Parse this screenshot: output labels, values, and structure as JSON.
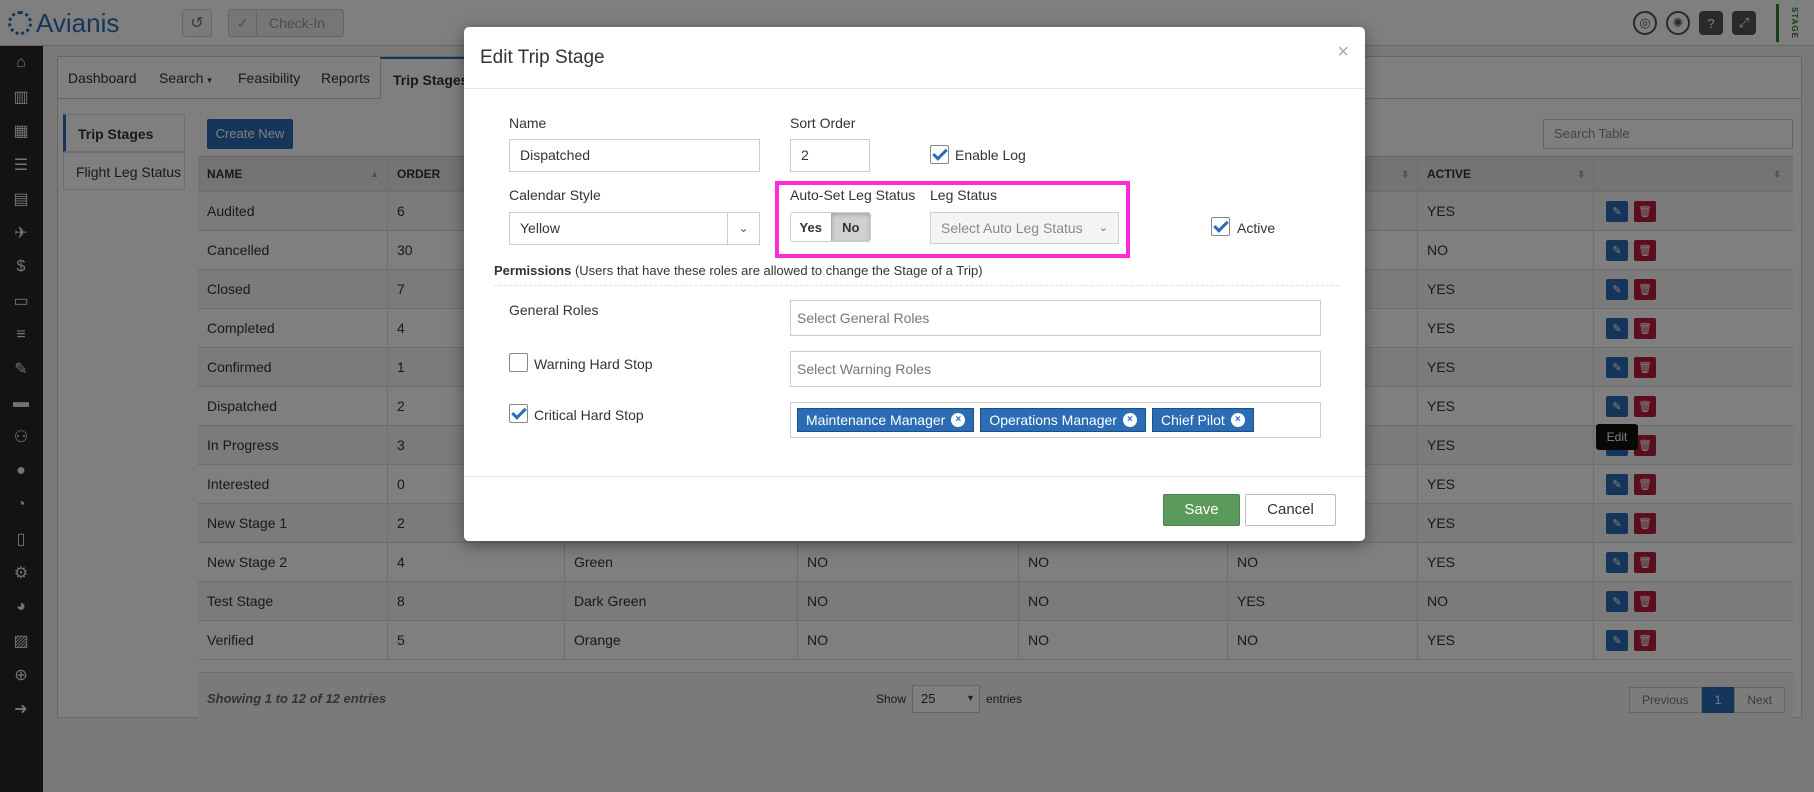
{
  "app": {
    "logo_text": "Avianis",
    "checkin_label": "Check-In",
    "stage_badge": "STAGE"
  },
  "tabs": [
    {
      "label": "Dashboard"
    },
    {
      "label": "Search",
      "caret": "▾"
    },
    {
      "label": "Feasibility"
    },
    {
      "label": "Reports"
    },
    {
      "label": "Trip Stages"
    }
  ],
  "side_tabs": [
    {
      "label": "Trip Stages"
    },
    {
      "label": "Flight Leg Status"
    }
  ],
  "toolbar": {
    "create_label": "Create New",
    "search_placeholder": "Search Table"
  },
  "table": {
    "headers": {
      "name": "NAME",
      "order": "ORDER",
      "active": "ACTIVE"
    },
    "rows": [
      {
        "name": "Audited",
        "order": "6",
        "active": "YES"
      },
      {
        "name": "Cancelled",
        "order": "30",
        "active": "NO"
      },
      {
        "name": "Closed",
        "order": "7",
        "active": "YES"
      },
      {
        "name": "Completed",
        "order": "4",
        "active": "YES"
      },
      {
        "name": "Confirmed",
        "order": "1",
        "active": "YES"
      },
      {
        "name": "Dispatched",
        "order": "2",
        "active": "YES"
      },
      {
        "name": "In Progress",
        "order": "3",
        "active": "YES"
      },
      {
        "name": "Interested",
        "order": "0",
        "active": "YES"
      },
      {
        "name": "New Stage 1",
        "order": "2",
        "active": "YES"
      },
      {
        "name": "New Stage 2",
        "order": "4",
        "color": "Green",
        "c4": "NO",
        "c5": "NO",
        "c6": "NO",
        "active": "YES"
      },
      {
        "name": "Test Stage",
        "order": "8",
        "color": "Dark Green",
        "c4": "NO",
        "c5": "NO",
        "c6": "YES",
        "active": "NO"
      },
      {
        "name": "Verified",
        "order": "5",
        "color": "Orange",
        "c4": "NO",
        "c5": "NO",
        "c6": "NO",
        "active": "YES"
      }
    ],
    "edit_tooltip": "Edit"
  },
  "footer": {
    "showing": "Showing 1 to 12 of 12 entries",
    "show_label": "Show",
    "entries_label": "entries",
    "page_length": "25",
    "prev": "Previous",
    "page": "1",
    "next": "Next"
  },
  "modal": {
    "title": "Edit Trip Stage",
    "close": "×",
    "name_label": "Name",
    "name_value": "Dispatched",
    "sort_label": "Sort Order",
    "sort_value": "2",
    "enable_log_label": "Enable Log",
    "calendar_label": "Calendar Style",
    "calendar_value": "Yellow",
    "auto_set_label": "Auto-Set Leg Status",
    "yes_label": "Yes",
    "no_label": "No",
    "leg_status_label": "Leg Status",
    "leg_status_placeholder": "Select Auto Leg Status",
    "active_label": "Active",
    "permissions_title": "Permissions",
    "permissions_note": "(Users that have these roles are allowed to change the Stage of a Trip)",
    "general_roles_label": "General Roles",
    "general_roles_placeholder": "Select General Roles",
    "warning_label": "Warning Hard Stop",
    "warning_placeholder": "Select Warning Roles",
    "critical_label": "Critical Hard Stop",
    "critical_tags": [
      "Maintenance Manager",
      "Operations Manager",
      "Chief Pilot"
    ],
    "save_label": "Save",
    "cancel_label": "Cancel"
  },
  "colors": {
    "primary": "#2a6db5",
    "danger": "#b71c3a",
    "save": "#5c9a5c",
    "highlight": "#ff2bd6"
  }
}
